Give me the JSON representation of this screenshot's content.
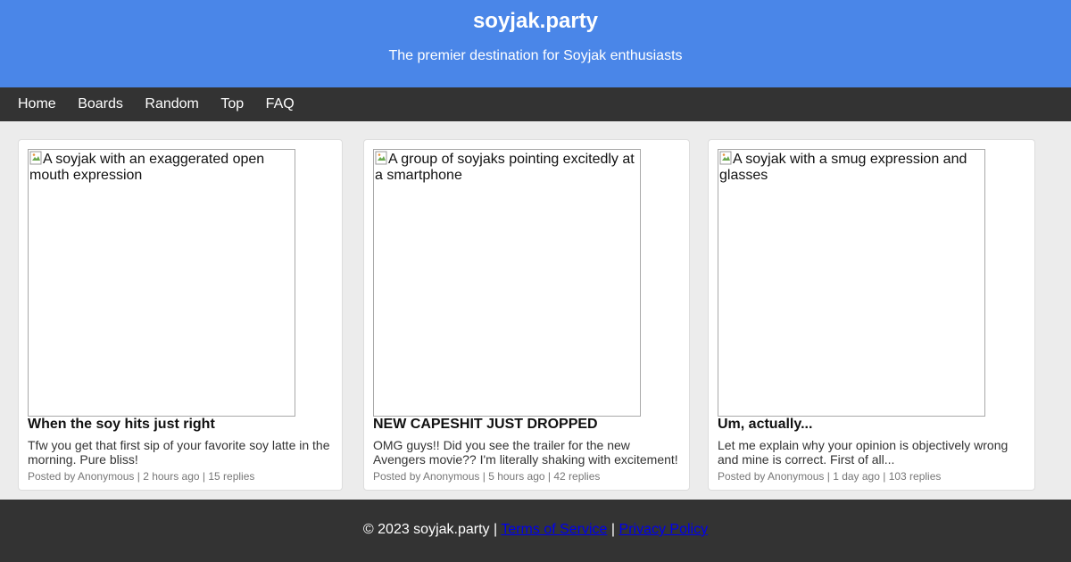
{
  "header": {
    "title": "soyjak.party",
    "tagline": "The premier destination for Soyjak enthusiasts"
  },
  "nav": {
    "items": [
      {
        "label": "Home"
      },
      {
        "label": "Boards"
      },
      {
        "label": "Random"
      },
      {
        "label": "Top"
      },
      {
        "label": "FAQ"
      }
    ]
  },
  "posts": [
    {
      "image_alt": "A soyjak with an exaggerated open mouth expression",
      "title": "When the soy hits just right",
      "excerpt": "Tfw you get that first sip of your favorite soy latte in the morning. Pure bliss!",
      "meta": "Posted by Anonymous | 2 hours ago | 15 replies"
    },
    {
      "image_alt": "A group of soyjaks pointing excitedly at a smartphone",
      "title": "NEW CAPESHIT JUST DROPPED",
      "excerpt": "OMG guys!! Did you see the trailer for the new Avengers movie?? I'm literally shaking with excitement!",
      "meta": "Posted by Anonymous | 5 hours ago | 42 replies"
    },
    {
      "image_alt": "A soyjak with a smug expression and glasses",
      "title": "Um, actually...",
      "excerpt": "Let me explain why your opinion is objectively wrong and mine is correct. First of all...",
      "meta": "Posted by Anonymous | 1 day ago | 103 replies"
    }
  ],
  "footer": {
    "copyright": "© 2023 soyjak.party |",
    "separator": "|",
    "terms_label": "Terms of Service",
    "privacy_label": "Privacy Policy"
  },
  "colors": {
    "header_bg": "#4a86e8",
    "nav_bg": "#333333",
    "page_bg": "#ececec",
    "link": "#0000ee"
  }
}
